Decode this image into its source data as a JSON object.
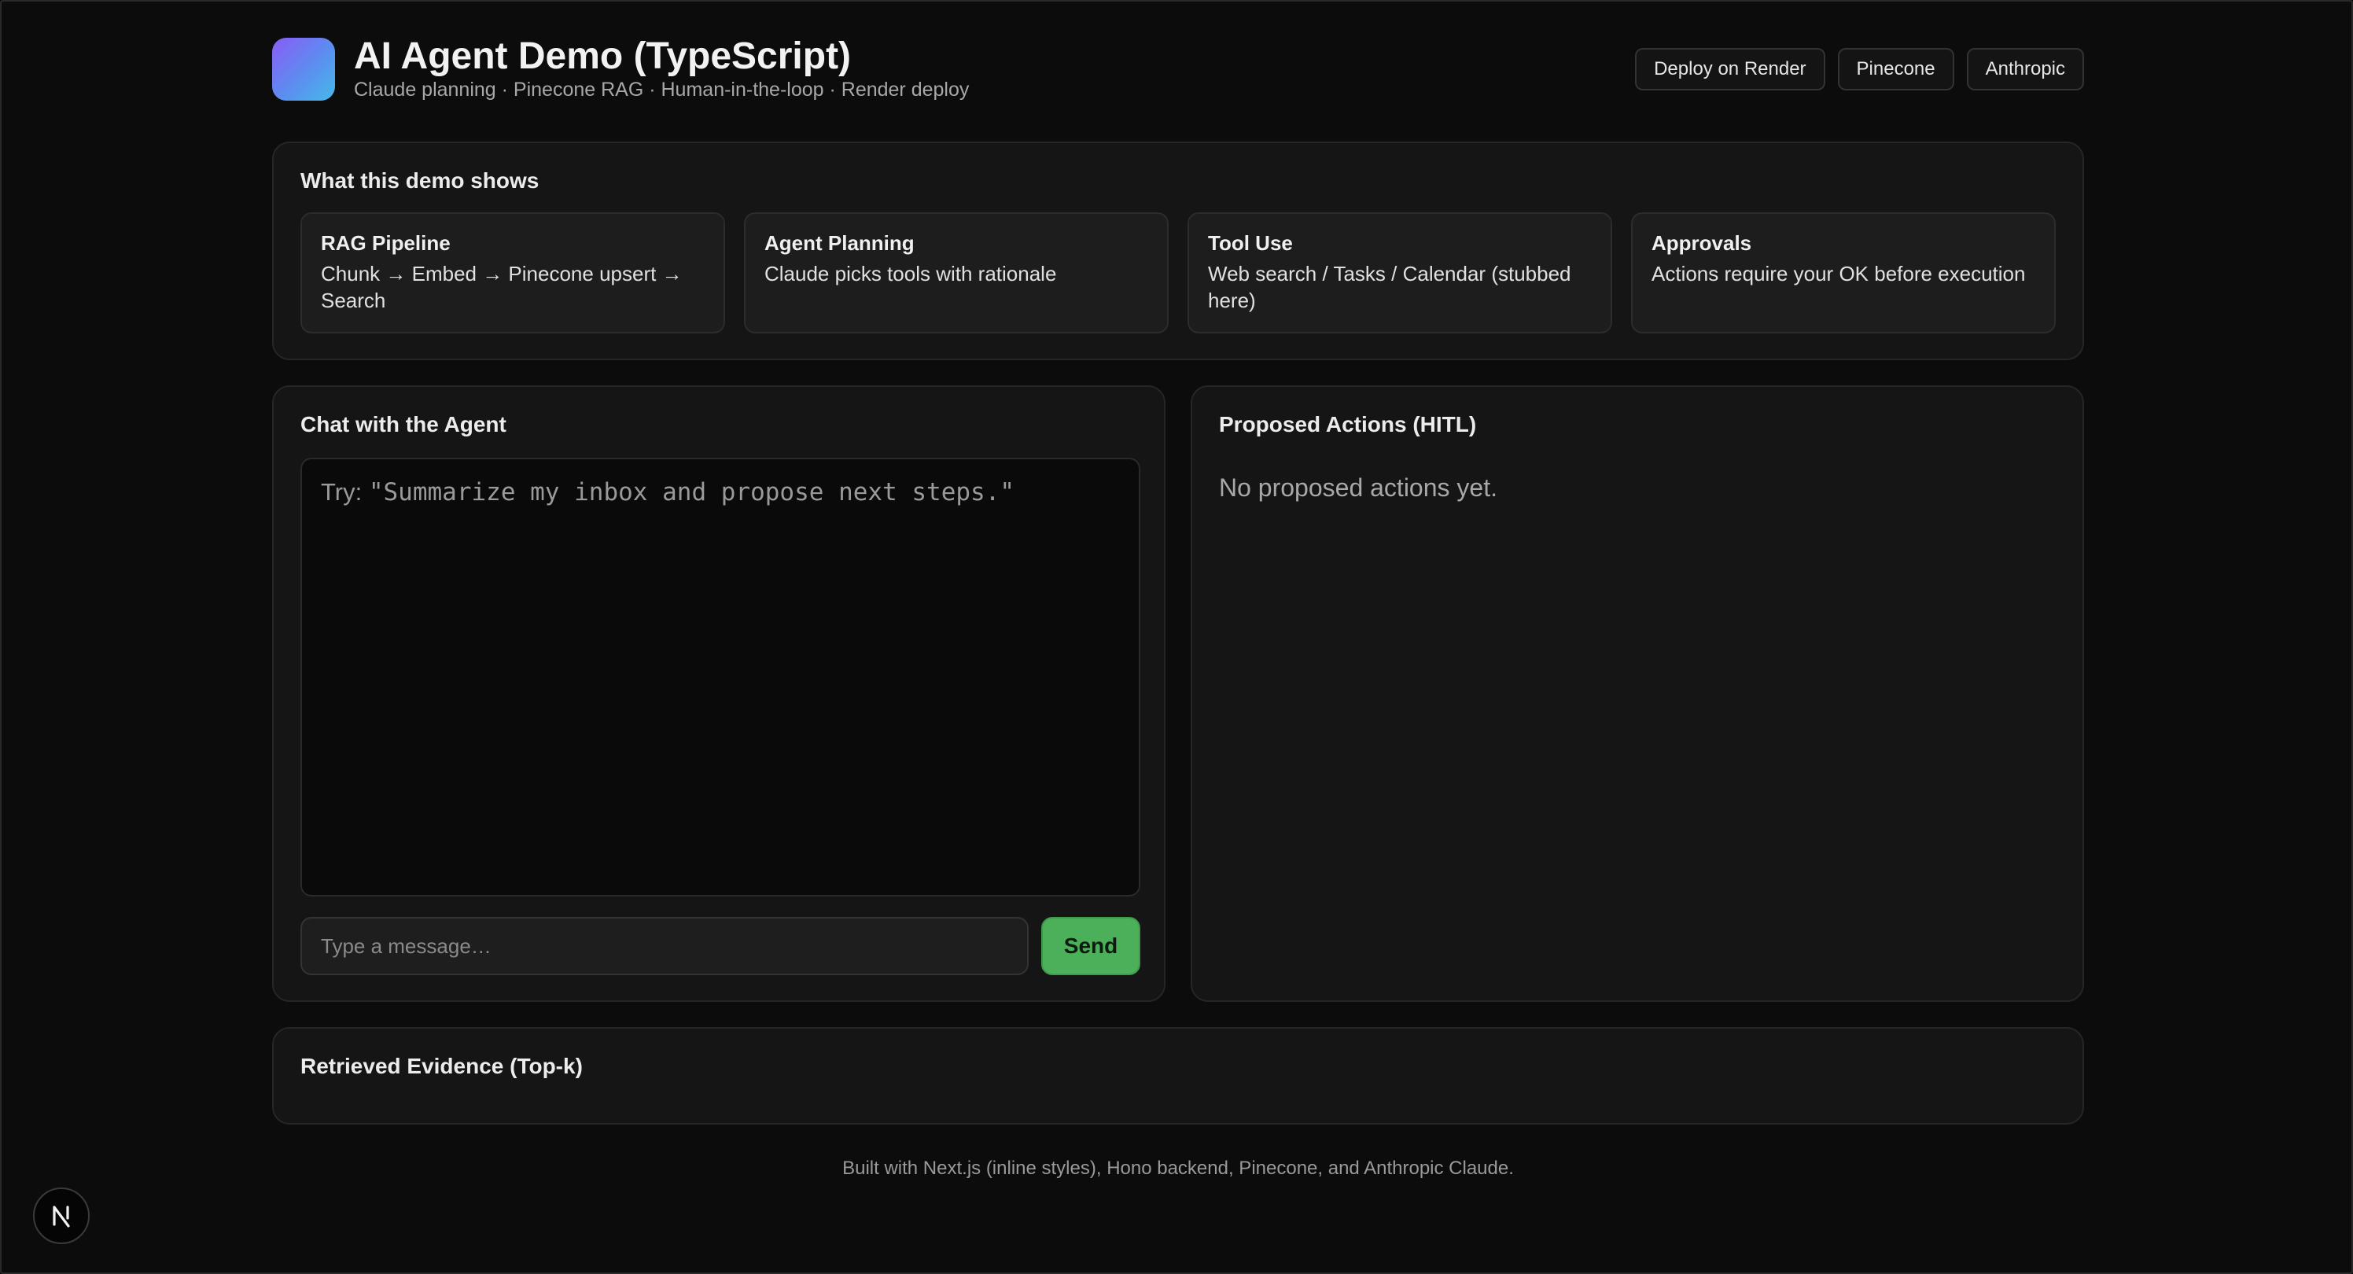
{
  "header": {
    "title": "AI Agent Demo (TypeScript)",
    "subtitle": "Claude planning · Pinecone RAG · Human-in-the-loop · Render deploy",
    "links": [
      "Deploy on Render",
      "Pinecone",
      "Anthropic"
    ]
  },
  "features": {
    "title": "What this demo shows",
    "items": [
      {
        "name": "RAG Pipeline",
        "desc": "Chunk → Embed → Pinecone upsert → Search"
      },
      {
        "name": "Agent Planning",
        "desc": "Claude picks tools with rationale"
      },
      {
        "name": "Tool Use",
        "desc": "Web search / Tasks / Calendar (stubbed here)"
      },
      {
        "name": "Approvals",
        "desc": "Actions require your OK before execution"
      }
    ]
  },
  "chat": {
    "title": "Chat with the Agent",
    "try_label": "Try: ",
    "try_text": "\"Summarize my inbox and propose next steps.\"",
    "input_placeholder": "Type a message…",
    "send_label": "Send"
  },
  "actions": {
    "title": "Proposed Actions (HITL)",
    "empty_text": "No proposed actions yet."
  },
  "evidence": {
    "title": "Retrieved Evidence (Top-k)"
  },
  "footer": {
    "text": "Built with Next.js (inline styles), Hono backend, Pinecone, and Anthropic Claude."
  },
  "colors": {
    "background": "#0c0c0c",
    "card": "#151515",
    "accent_green": "#4cb05a"
  },
  "icons": {
    "logo": "gradient-square-logo",
    "dev_badge": "nextjs-n-icon"
  }
}
